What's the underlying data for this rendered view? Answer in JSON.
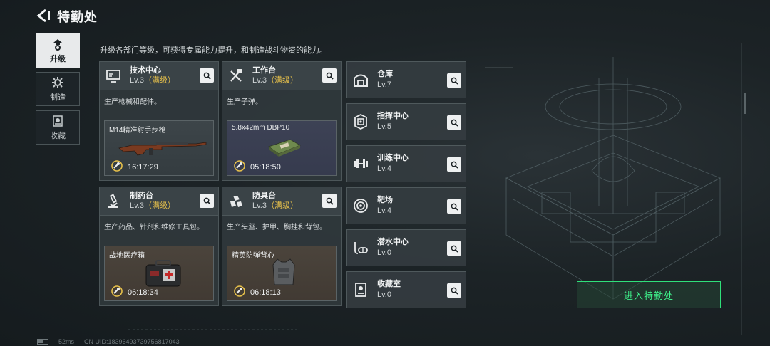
{
  "header": {
    "title": "特勤处"
  },
  "description": "升级各部门等级，可获得专属能力提升，和制造战斗物资的能力。",
  "tabs": [
    {
      "label": "升级",
      "active": true,
      "icon": "upgrade-icon"
    },
    {
      "label": "制造",
      "active": false,
      "icon": "gear-icon"
    },
    {
      "label": "收藏",
      "active": false,
      "icon": "collection-icon"
    }
  ],
  "departments": [
    {
      "name": "技术中心",
      "level": "Lv.3",
      "full": "（满级）",
      "sub": "生产枪械和配件。",
      "item": "M14精准射手步枪",
      "time": "16:17:29",
      "icon": "monitor-icon"
    },
    {
      "name": "工作台",
      "level": "Lv.3",
      "full": "（满级）",
      "sub": "生产子弹。",
      "item": "5.8x42mm DBP10",
      "time": "05:18:50",
      "icon": "tools-icon"
    },
    {
      "name": "制药台",
      "level": "Lv.3",
      "full": "（满级）",
      "sub": "生产药品、针剂和维修工具包。",
      "item": "战地医疗箱",
      "time": "06:18:34",
      "icon": "microscope-icon"
    },
    {
      "name": "防具台",
      "level": "Lv.3",
      "full": "（满级）",
      "sub": "生产头盔、护甲、胸挂和背包。",
      "item": "精英防弹背心",
      "time": "06:18:13",
      "icon": "armor-icon"
    }
  ],
  "facilities": [
    {
      "name": "仓库",
      "level": "Lv.7",
      "icon": "warehouse-icon"
    },
    {
      "name": "指挥中心",
      "level": "Lv.5",
      "icon": "chip-icon"
    },
    {
      "name": "训练中心",
      "level": "Lv.4",
      "icon": "dumbbell-icon"
    },
    {
      "name": "靶场",
      "level": "Lv.4",
      "icon": "target-icon"
    },
    {
      "name": "潜水中心",
      "level": "Lv.0",
      "icon": "diving-icon"
    },
    {
      "name": "收藏室",
      "level": "Lv.0",
      "icon": "collection-room-icon"
    }
  ],
  "enter_button": "进入特勤处",
  "footer": {
    "ping": "52ms",
    "uid": "CN UID:18396493739756817043"
  },
  "colors": {
    "accent_green": "#3ef08a",
    "max_level": "#e7c14b"
  }
}
